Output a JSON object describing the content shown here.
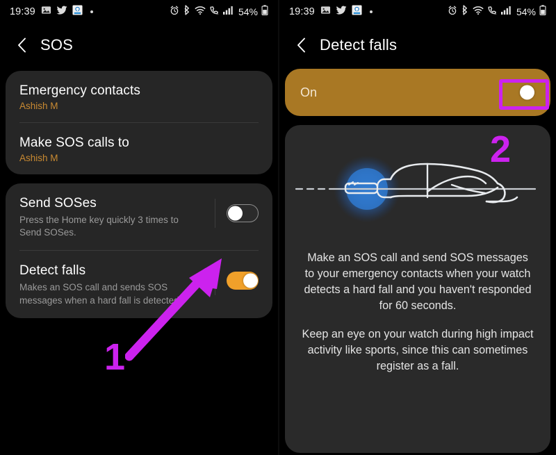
{
  "status_bar": {
    "time": "19:39",
    "battery_percent": "54%",
    "left_icons": [
      "gallery-icon",
      "twitter-icon",
      "app-notification-icon",
      "more-dot-icon"
    ],
    "right_icons": [
      "alarm-icon",
      "bluetooth-icon",
      "wifi-icon",
      "volte-call-icon",
      "signal-bars-icon",
      "battery-icon"
    ]
  },
  "left_screen": {
    "title": "SOS",
    "back_label": "‹",
    "card_contacts": {
      "rows": [
        {
          "title": "Emergency contacts",
          "subtitle": "Ashish M"
        },
        {
          "title": "Make SOS calls to",
          "subtitle": "Ashish M"
        }
      ]
    },
    "card_options": {
      "rows": [
        {
          "title": "Send SOSes",
          "subtitle": "Press the Home key quickly 3 times to Send SOSes.",
          "toggle_state": "off"
        },
        {
          "title": "Detect falls",
          "subtitle": "Makes an SOS call and sends SOS messages when a hard fall is detected.",
          "toggle_state": "on"
        }
      ]
    }
  },
  "right_screen": {
    "title": "Detect falls",
    "back_label": "‹",
    "banner": {
      "label": "On",
      "toggle_state": "on"
    },
    "illustration_name": "person-lying-down-with-watch-illustration",
    "description_paragraph_1": "Make an SOS call and send SOS messages to your emergency contacts when your watch detects a hard fall and you haven't responded for 60 seconds.",
    "description_paragraph_2": "Keep an eye on your watch during high impact activity like sports, since this can sometimes register as a fall."
  },
  "annotations": {
    "marker_one": "1",
    "marker_two": "2",
    "highlight_color": "#cc22ee"
  },
  "colors": {
    "background": "#000000",
    "card": "#262626",
    "card_right": "#2a2a2a",
    "accent_orange": "#f0a02a",
    "banner_bronze": "#a97824",
    "subtitle_orange": "#c98a32",
    "annotation_magenta": "#cc22ee"
  }
}
